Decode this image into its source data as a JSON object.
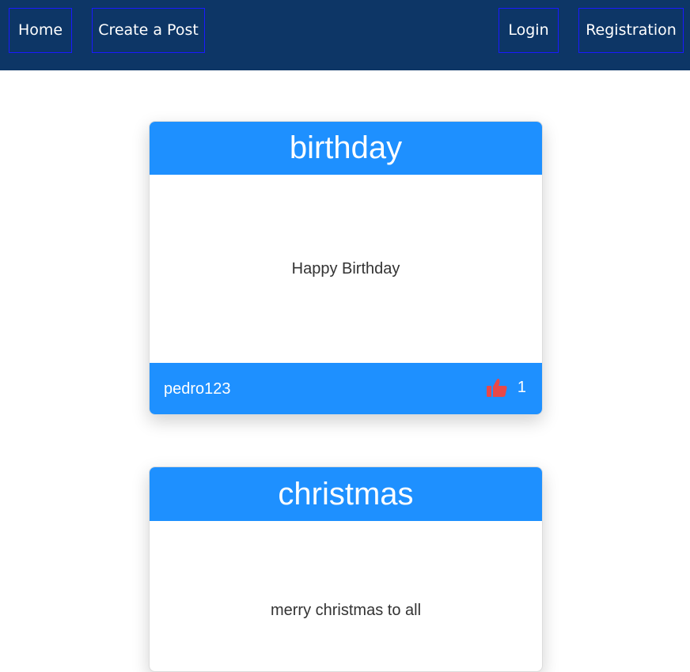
{
  "nav": {
    "home": "Home",
    "create_post": "Create a Post",
    "login": "Login",
    "registration": "Registration"
  },
  "posts": [
    {
      "title": "birthday",
      "body": "Happy Birthday",
      "author": "pedro123",
      "likes": "1"
    },
    {
      "title": "christmas",
      "body": "merry christmas to all"
    }
  ],
  "colors": {
    "navbar_bg": "#0d3666",
    "accent": "#1e90ff",
    "like_icon": "#e84848"
  },
  "icons": {
    "like": "thumbs-up-icon"
  }
}
